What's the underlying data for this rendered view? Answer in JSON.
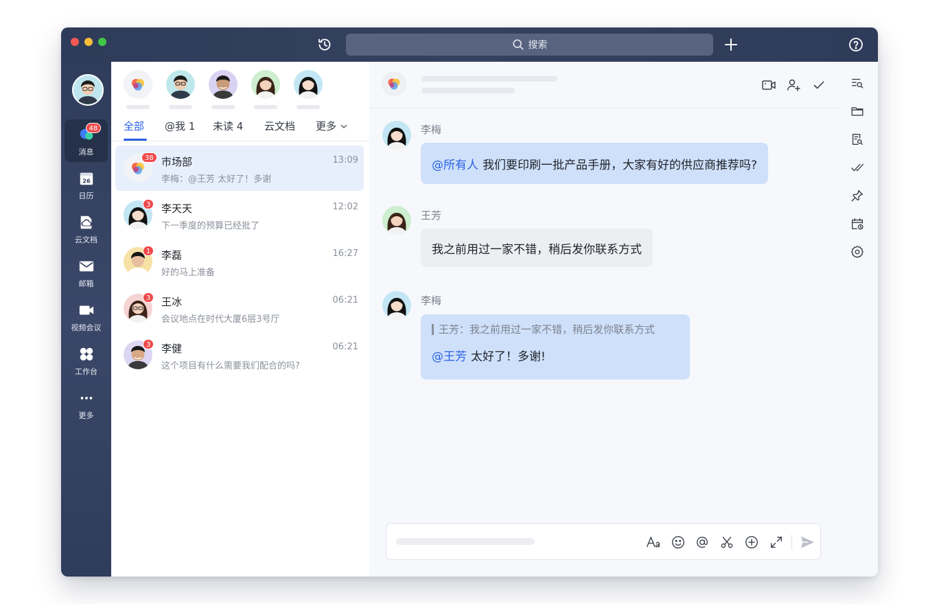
{
  "titlebar": {
    "search_placeholder": "搜索"
  },
  "sidebar": {
    "items": [
      {
        "label": "消息",
        "icon": "chat-bubble-icon",
        "badge": "48"
      },
      {
        "label": "日历",
        "icon": "calendar-icon",
        "day": "26"
      },
      {
        "label": "云文档",
        "icon": "cloud-doc-icon"
      },
      {
        "label": "邮箱",
        "icon": "mail-icon"
      },
      {
        "label": "视频会议",
        "icon": "video-camera-icon"
      },
      {
        "label": "工作台",
        "icon": "workbench-icon"
      },
      {
        "label": "更多",
        "icon": "more-dots-icon"
      }
    ]
  },
  "tabs": [
    {
      "label": "全部"
    },
    {
      "label": "@我 1"
    },
    {
      "label": "未读 4"
    },
    {
      "label": "云文档"
    },
    {
      "label": "更多"
    }
  ],
  "conversations": [
    {
      "name": "市场部",
      "time": "13:09",
      "preview": "李梅：@王芳 太好了！多谢",
      "badge": "38"
    },
    {
      "name": "李天天",
      "time": "12:02",
      "preview": "下一季度的预算已经批了",
      "badge": "3"
    },
    {
      "name": "李磊",
      "time": "16:27",
      "preview": "好的马上准备",
      "badge": "1"
    },
    {
      "name": "王冰",
      "time": "06:21",
      "preview": "会议地点在时代大厦6层3号厅",
      "badge": "3"
    },
    {
      "name": "李健",
      "time": "06:21",
      "preview": "这个项目有什么需要我们配合的吗?",
      "badge": "3"
    }
  ],
  "messages": [
    {
      "sender": "李梅",
      "mention": "@所有人",
      "text": "我们要印刷一批产品手册，大家有好的供应商推荐吗?"
    },
    {
      "sender": "王芳",
      "text": "我之前用过一家不错，稍后发你联系方式"
    },
    {
      "sender": "李梅",
      "quote": "王芳：我之前用过一家不错，稍后发你联系方式",
      "mention": "@王芳",
      "text": "太好了！多谢!"
    }
  ],
  "colors": {
    "accent": "#2a62e4",
    "badge": "#f0494a",
    "sidebar": "#2f3c5b",
    "bubble_self": "#cfe0fb",
    "bubble_other": "#eceef2"
  }
}
